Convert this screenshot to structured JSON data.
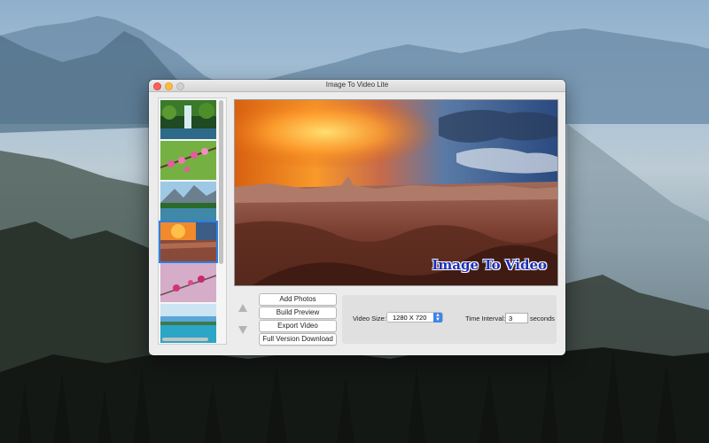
{
  "window": {
    "title": "Image To Video Lite"
  },
  "preview": {
    "watermark": "Image To Video"
  },
  "buttons": {
    "add_photos": "Add Photos",
    "build_preview": "Build Preview",
    "export_video": "Export Video",
    "full_version": "Full Version Download"
  },
  "settings": {
    "video_size_label": "Video Size:",
    "video_size_value": "1280 X 720",
    "time_interval_label": "Time Interval:",
    "time_interval_value": "3",
    "time_unit": "seconds"
  },
  "thumbnails": [
    {
      "subject": "waterfall",
      "selected": false
    },
    {
      "subject": "pink-blossoms",
      "selected": false
    },
    {
      "subject": "mountain-lake",
      "selected": false
    },
    {
      "subject": "canyon-sunset",
      "selected": true
    },
    {
      "subject": "pink-blossoms-2",
      "selected": false
    },
    {
      "subject": "tropical-beach",
      "selected": false
    }
  ],
  "colors": {
    "accent": "#3b87e8",
    "selection": "#2d7fe0",
    "watermark": "#1c2fb8"
  }
}
